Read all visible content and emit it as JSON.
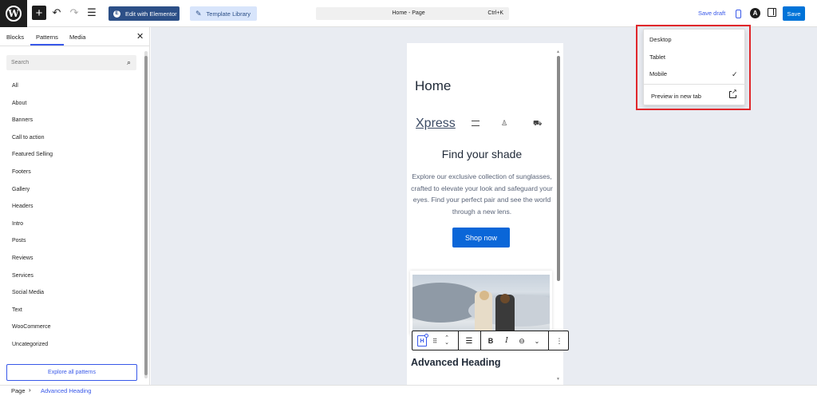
{
  "topbar": {
    "elementor_label": "Edit with Elementor",
    "template_label": "Template Library",
    "document_title": "Home - Page",
    "shortcut": "Ctrl+K",
    "save_draft_label": "Save draft",
    "save_label": "Save"
  },
  "sidebar": {
    "tabs": [
      "Blocks",
      "Patterns",
      "Media"
    ],
    "search_placeholder": "Search",
    "categories": [
      "All",
      "About",
      "Banners",
      "Call to action",
      "Featured Selling",
      "Footers",
      "Gallery",
      "Headers",
      "Intro",
      "Posts",
      "Reviews",
      "Services",
      "Social Media",
      "Text",
      "WooCommerce",
      "Uncategorized"
    ],
    "explore_label": "Explore all patterns"
  },
  "preview": {
    "home_title": "Home",
    "logo_text": "Xpress",
    "heading": "Find your shade",
    "paragraph": "Explore our exclusive collection of sunglasses, crafted to elevate your look and safeguard your eyes. Find your perfect pair and see the world through a new lens.",
    "shop_button": "Shop now",
    "advanced_heading": "Advanced Heading"
  },
  "device_menu": {
    "items": [
      "Desktop",
      "Tablet",
      "Mobile"
    ],
    "selected": "Mobile",
    "preview_new_tab": "Preview in new tab"
  },
  "footer": {
    "crumb_root": "Page",
    "crumb_current": "Advanced Heading"
  },
  "colors": {
    "accent": "#3858e9",
    "elementor": "#2c4f87",
    "save": "#0073d8",
    "highlight": "#e0272b"
  }
}
